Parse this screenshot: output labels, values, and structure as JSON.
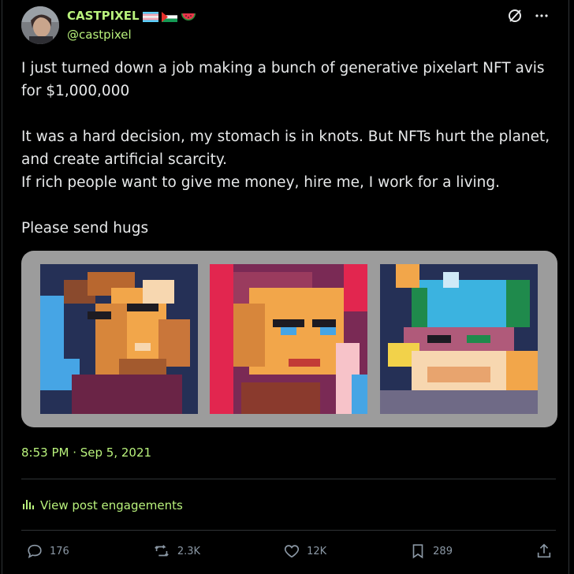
{
  "author": {
    "display_name": "CASTPIXEL",
    "handle": "@castpixel",
    "badges": [
      "trans-flag-icon",
      "palestine-flag-icon",
      "watermelon-icon"
    ]
  },
  "post": {
    "text": "I just turned down a job making a bunch of generative pixelart NFT avis for $1,000,000\n\nIt was a hard decision, my stomach is in knots. But NFTs hurt the planet, and create artificial scarcity.\nIf rich people want to give me money, hire me, I work for a living.\n\nPlease send hugs",
    "timestamp": "8:53 PM · Sep 5, 2021"
  },
  "engagements": {
    "label": "View post engagements"
  },
  "actions": {
    "replies": "176",
    "reposts": "2.3K",
    "likes": "12K",
    "bookmarks": "289"
  },
  "colors": {
    "accent": "#b9f27c",
    "text": "#e7e9ea",
    "muted": "#8b98a5",
    "background": "#000000"
  }
}
